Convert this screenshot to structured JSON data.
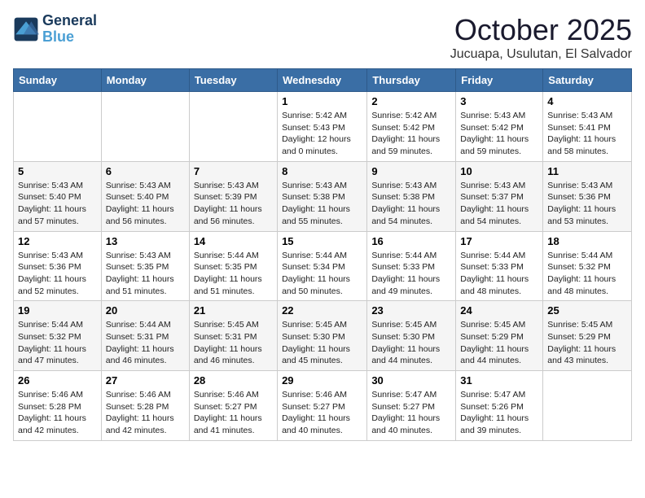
{
  "logo": {
    "line1": "General",
    "line2": "Blue"
  },
  "title": "October 2025",
  "subtitle": "Jucuapa, Usulutan, El Salvador",
  "days_of_week": [
    "Sunday",
    "Monday",
    "Tuesday",
    "Wednesday",
    "Thursday",
    "Friday",
    "Saturday"
  ],
  "weeks": [
    [
      {
        "day": "",
        "info": ""
      },
      {
        "day": "",
        "info": ""
      },
      {
        "day": "",
        "info": ""
      },
      {
        "day": "1",
        "info": "Sunrise: 5:42 AM\nSunset: 5:43 PM\nDaylight: 12 hours\nand 0 minutes."
      },
      {
        "day": "2",
        "info": "Sunrise: 5:42 AM\nSunset: 5:42 PM\nDaylight: 11 hours\nand 59 minutes."
      },
      {
        "day": "3",
        "info": "Sunrise: 5:43 AM\nSunset: 5:42 PM\nDaylight: 11 hours\nand 59 minutes."
      },
      {
        "day": "4",
        "info": "Sunrise: 5:43 AM\nSunset: 5:41 PM\nDaylight: 11 hours\nand 58 minutes."
      }
    ],
    [
      {
        "day": "5",
        "info": "Sunrise: 5:43 AM\nSunset: 5:40 PM\nDaylight: 11 hours\nand 57 minutes."
      },
      {
        "day": "6",
        "info": "Sunrise: 5:43 AM\nSunset: 5:40 PM\nDaylight: 11 hours\nand 56 minutes."
      },
      {
        "day": "7",
        "info": "Sunrise: 5:43 AM\nSunset: 5:39 PM\nDaylight: 11 hours\nand 56 minutes."
      },
      {
        "day": "8",
        "info": "Sunrise: 5:43 AM\nSunset: 5:38 PM\nDaylight: 11 hours\nand 55 minutes."
      },
      {
        "day": "9",
        "info": "Sunrise: 5:43 AM\nSunset: 5:38 PM\nDaylight: 11 hours\nand 54 minutes."
      },
      {
        "day": "10",
        "info": "Sunrise: 5:43 AM\nSunset: 5:37 PM\nDaylight: 11 hours\nand 54 minutes."
      },
      {
        "day": "11",
        "info": "Sunrise: 5:43 AM\nSunset: 5:36 PM\nDaylight: 11 hours\nand 53 minutes."
      }
    ],
    [
      {
        "day": "12",
        "info": "Sunrise: 5:43 AM\nSunset: 5:36 PM\nDaylight: 11 hours\nand 52 minutes."
      },
      {
        "day": "13",
        "info": "Sunrise: 5:43 AM\nSunset: 5:35 PM\nDaylight: 11 hours\nand 51 minutes."
      },
      {
        "day": "14",
        "info": "Sunrise: 5:44 AM\nSunset: 5:35 PM\nDaylight: 11 hours\nand 51 minutes."
      },
      {
        "day": "15",
        "info": "Sunrise: 5:44 AM\nSunset: 5:34 PM\nDaylight: 11 hours\nand 50 minutes."
      },
      {
        "day": "16",
        "info": "Sunrise: 5:44 AM\nSunset: 5:33 PM\nDaylight: 11 hours\nand 49 minutes."
      },
      {
        "day": "17",
        "info": "Sunrise: 5:44 AM\nSunset: 5:33 PM\nDaylight: 11 hours\nand 48 minutes."
      },
      {
        "day": "18",
        "info": "Sunrise: 5:44 AM\nSunset: 5:32 PM\nDaylight: 11 hours\nand 48 minutes."
      }
    ],
    [
      {
        "day": "19",
        "info": "Sunrise: 5:44 AM\nSunset: 5:32 PM\nDaylight: 11 hours\nand 47 minutes."
      },
      {
        "day": "20",
        "info": "Sunrise: 5:44 AM\nSunset: 5:31 PM\nDaylight: 11 hours\nand 46 minutes."
      },
      {
        "day": "21",
        "info": "Sunrise: 5:45 AM\nSunset: 5:31 PM\nDaylight: 11 hours\nand 46 minutes."
      },
      {
        "day": "22",
        "info": "Sunrise: 5:45 AM\nSunset: 5:30 PM\nDaylight: 11 hours\nand 45 minutes."
      },
      {
        "day": "23",
        "info": "Sunrise: 5:45 AM\nSunset: 5:30 PM\nDaylight: 11 hours\nand 44 minutes."
      },
      {
        "day": "24",
        "info": "Sunrise: 5:45 AM\nSunset: 5:29 PM\nDaylight: 11 hours\nand 44 minutes."
      },
      {
        "day": "25",
        "info": "Sunrise: 5:45 AM\nSunset: 5:29 PM\nDaylight: 11 hours\nand 43 minutes."
      }
    ],
    [
      {
        "day": "26",
        "info": "Sunrise: 5:46 AM\nSunset: 5:28 PM\nDaylight: 11 hours\nand 42 minutes."
      },
      {
        "day": "27",
        "info": "Sunrise: 5:46 AM\nSunset: 5:28 PM\nDaylight: 11 hours\nand 42 minutes."
      },
      {
        "day": "28",
        "info": "Sunrise: 5:46 AM\nSunset: 5:27 PM\nDaylight: 11 hours\nand 41 minutes."
      },
      {
        "day": "29",
        "info": "Sunrise: 5:46 AM\nSunset: 5:27 PM\nDaylight: 11 hours\nand 40 minutes."
      },
      {
        "day": "30",
        "info": "Sunrise: 5:47 AM\nSunset: 5:27 PM\nDaylight: 11 hours\nand 40 minutes."
      },
      {
        "day": "31",
        "info": "Sunrise: 5:47 AM\nSunset: 5:26 PM\nDaylight: 11 hours\nand 39 minutes."
      },
      {
        "day": "",
        "info": ""
      }
    ]
  ]
}
